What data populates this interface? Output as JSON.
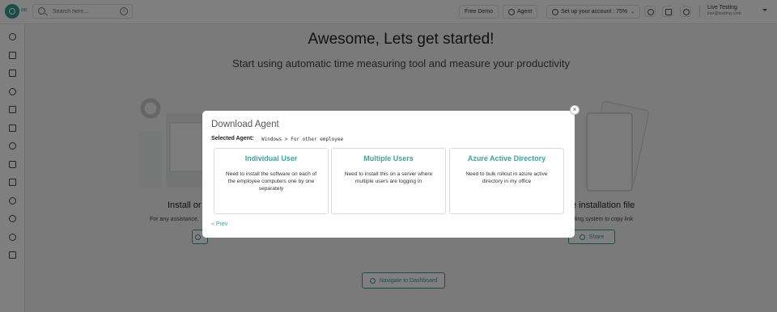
{
  "header": {
    "logo_sub": "oo",
    "search_placeholder": "Search here...",
    "free_demo": "Free Demo",
    "agent": "Agent",
    "setup_account": "Set up your account : 75%",
    "user_name": "Live Testing",
    "user_email": "live@testing.com"
  },
  "page": {
    "title": "Awesome, Lets get started!",
    "subtitle": "Start using automatic time measuring tool and measure your productivity",
    "card_left_title": "Install or",
    "card_left_desc": "For any assistance,",
    "card_right_title": "e installation file",
    "card_right_desc": "ating system to copy link",
    "share": "Share",
    "navigate": "Navigate to Dashboard"
  },
  "modal": {
    "title": "Download Agent",
    "selected_label": "Selected Agent:",
    "selected_value": "Windows > For other employee",
    "options": [
      {
        "title": "Individual User",
        "desc": "Need to install the software on each of the employee computers one by one separately"
      },
      {
        "title": "Multiple Users",
        "desc": "Need to install this on a server where multiple users are logging in"
      },
      {
        "title": "Azure Active Directory",
        "desc": "Need to bulk rollout in azure active directory in my office"
      }
    ],
    "prev": "Prev",
    "close": "×"
  },
  "colors": {
    "accent": "#3aa6a0",
    "brand": "#2f9e8f"
  }
}
